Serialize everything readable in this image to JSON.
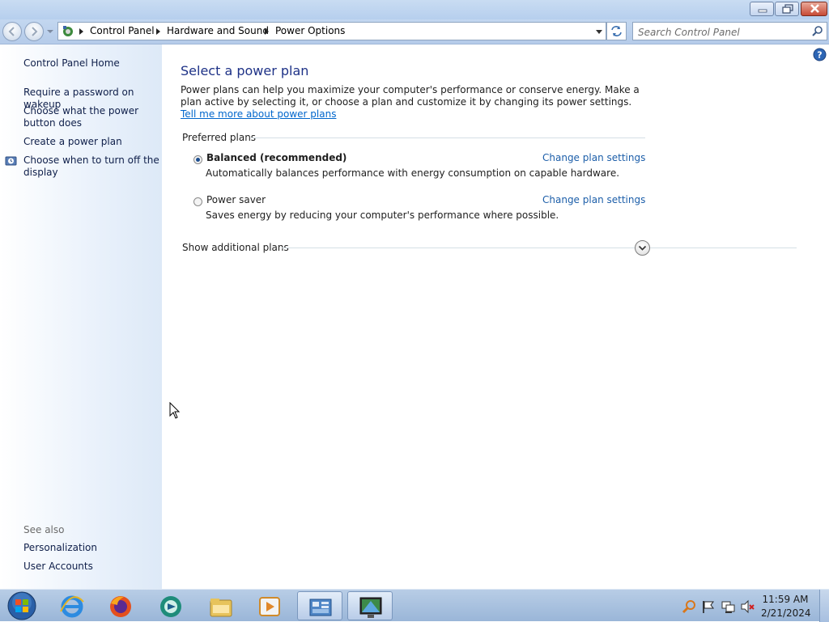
{
  "window": {
    "caption_buttons": [
      "minimize",
      "maximize",
      "close"
    ]
  },
  "address": {
    "crumbs": [
      "Control Panel",
      "Hardware and Sound",
      "Power Options"
    ]
  },
  "search": {
    "placeholder": "Search Control Panel"
  },
  "sidebar": {
    "home": "Control Panel Home",
    "links": [
      "Require a password on wakeup",
      "Choose what the power button does",
      "Create a power plan",
      "Choose when to turn off the display"
    ],
    "see_also_label": "See also",
    "see_also": [
      "Personalization",
      "User Accounts"
    ]
  },
  "main": {
    "title": "Select a power plan",
    "intro": "Power plans can help you maximize your computer's performance or conserve energy. Make a plan active by selecting it, or choose a plan and customize it by changing its power settings.",
    "intro_link": "Tell me more about power plans",
    "preferred_label": "Preferred plans",
    "plans": [
      {
        "name": "Balanced (recommended)",
        "selected": true,
        "description": "Automatically balances performance with energy consumption on capable hardware.",
        "link": "Change plan settings"
      },
      {
        "name": "Power saver",
        "selected": false,
        "description": "Saves energy by reducing your computer's performance where possible.",
        "link": "Change plan settings"
      }
    ],
    "additional_label": "Show additional plans"
  },
  "taskbar": {
    "apps": [
      "start-orb",
      "internet-explorer-icon",
      "firefox-icon",
      "media-app-icon",
      "windows-explorer-icon",
      "media-player-icon",
      "control-panel-icon",
      "remote-desktop-icon"
    ],
    "clock_time": "11:59 AM",
    "clock_date": "2/21/2024"
  },
  "colors": {
    "link": "#1c5ea9",
    "title": "#1e3287",
    "sidebar_link": "#0f1f4a"
  }
}
